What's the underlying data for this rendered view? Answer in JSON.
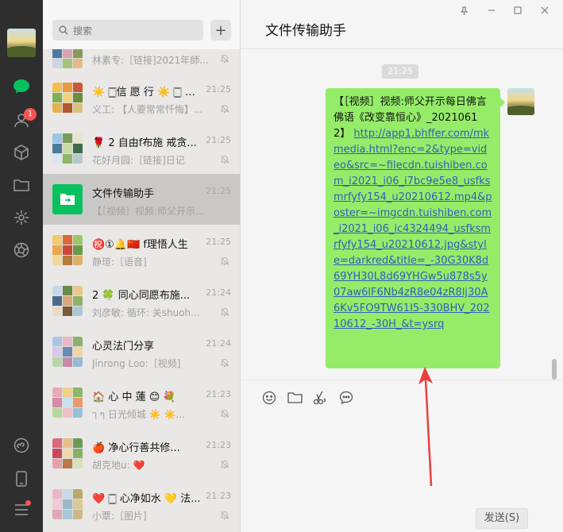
{
  "search": {
    "placeholder": "搜索"
  },
  "rail": {
    "badge_count": "1"
  },
  "chats": [
    {
      "name": "",
      "time": "",
      "preview": "林素专:［链接]2021年師...",
      "muted": true
    },
    {
      "name": "☀️ 🀆信 愿 行 ☀️ 🀆 布...",
      "time": "21:25",
      "preview": "义工: 【人要常常忏悔】...",
      "muted": true
    },
    {
      "name": "🌹 2 自由f布施 戒贪...",
      "time": "21:25",
      "preview": "花好月园:［链接]日记",
      "muted": true
    },
    {
      "name": "文件传输助手",
      "time": "21:25",
      "preview": "【［视频］视频:师父开示...",
      "muted": false
    },
    {
      "name": "㊗️①🔔🇨🇳 f理悟人生",
      "time": "21:25",
      "preview": "静瑄:［语音]",
      "muted": true
    },
    {
      "name": "2 🍀 同心同愿布施...",
      "time": "21:24",
      "preview": "刘彦敏: 循环: 关shuoh...",
      "muted": true
    },
    {
      "name": "心灵法门分享",
      "time": "21:24",
      "preview": "Jinrong Loo:［视频]",
      "muted": true
    },
    {
      "name": "🏠 心 中 蓮 😊 💐",
      "time": "21:23",
      "preview": "ๅ ๆ 日光倾城 ☀️ ☀️...",
      "muted": true
    },
    {
      "name": "🍎 净心行善共修...",
      "time": "21:23",
      "preview": "胡克地u: ❤️",
      "muted": true
    },
    {
      "name": "❤️ 🀆 心净如水 💛 法...",
      "time": "21:23",
      "preview": "小覃:［图片]",
      "muted": true
    }
  ],
  "pane": {
    "title": "文件传输助手",
    "time_stamp": "21:25",
    "message_head": "【［视频］视频:师父开示每日佛言佛语《改变靠恒心》_20210612】",
    "message_link": "http://app1.bhffer.com/mkmedia.html?enc=2&type=video&src=~filecdn.tuishiben.com_i2021_i06_i7bc9e5e8_usfksmrfyfy154_u20210612.mp4&poster=~imgcdn.tuishiben.com_i2021_i06_ic4324494_usfksmrfyfy154_u20210612.jpg&style=darkred&title=_-30G30K8d69YH30L8d69YHGw5u878s5y07aw6lF6Nb4zR8e04zR8lj30A6Kv5FO9TW61I5-330BHV_20210612_-30H_&t=ysrq"
  },
  "input": {
    "send_label": "发送(S)"
  },
  "colors": {
    "bubble": "#95ec69",
    "link": "#2e62b8",
    "accent": "#07c160",
    "arrow": "#e8413c"
  },
  "icons": [
    "search-icon",
    "plus-icon",
    "chat-icon",
    "contacts-icon",
    "cube-icon",
    "folder-icon",
    "moments-icon",
    "aperture-icon",
    "miniprogram-icon",
    "phone-icon",
    "menu-icon",
    "emoji-icon",
    "scissors-icon",
    "bubble-icon",
    "mute-icon",
    "pin-icon",
    "minimize-icon",
    "maximize-icon",
    "close-icon"
  ]
}
